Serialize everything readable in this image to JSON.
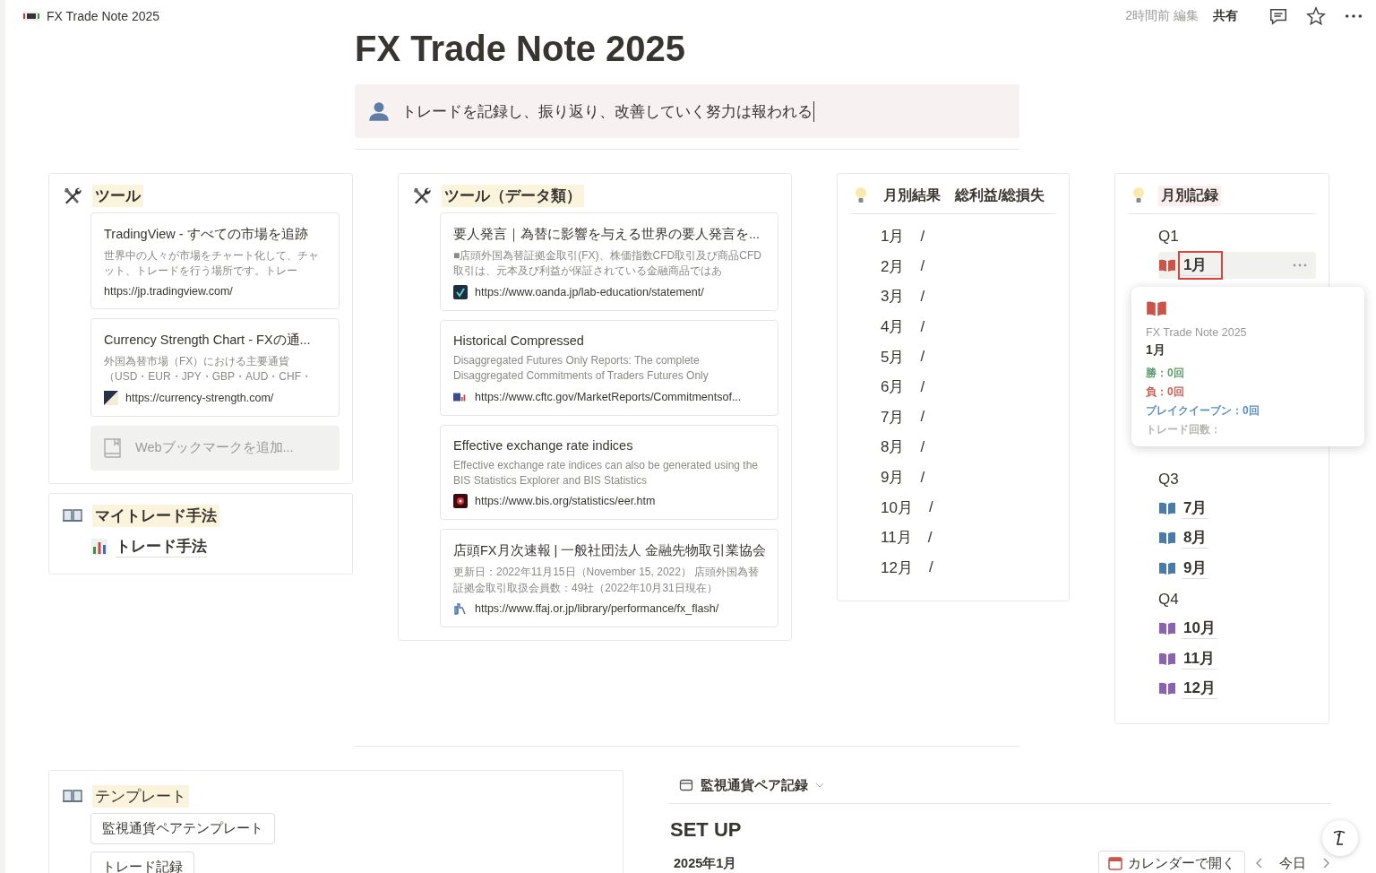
{
  "top_bar": {
    "breadcrumb": "FX Trade Note 2025",
    "edited": "2時間前 編集",
    "share": "共有"
  },
  "title": "FX Trade Note 2025",
  "callout": "トレードを記録し、振り返り、改善していく努力は報われる",
  "columns": [
    {
      "cards": [
        {
          "kind": "bookmarks",
          "heading": "ツール",
          "bookmarks": [
            {
              "title": "TradingView - すべての市場を追跡",
              "description": "世界中の人々が市場をチャート化して、チャット、トレードを行う場所です。トレー",
              "url": "https://jp.tradingview.com/"
            },
            {
              "title": "Currency Strength Chart - FXの通...",
              "description": "外国為替市場（FX）における主要通貨（USD・EUR・JPY・GBP・AUD・CHF・",
              "url": "https://currency-strength.com/"
            }
          ],
          "add_button": "Webブックマークを追加..."
        },
        {
          "kind": "pages",
          "heading": "マイトレード手法",
          "pages": [
            {
              "label": "トレード手法"
            }
          ]
        }
      ]
    },
    {
      "cards": [
        {
          "kind": "bookmarks",
          "heading": "ツール（データ類）",
          "bookmarks": [
            {
              "title": "要人発言｜為替に影響を与える世界の要人発言を...",
              "description": "■店頭外国為替証拠金取引(FX)、株価指数CFD取引及び商品CFD取引は、元本及び利益が保証されている金融商品ではあ",
              "url": "https://www.oanda.jp/lab-education/statement/"
            },
            {
              "title": "Historical Compressed",
              "description": "Disaggregated Futures Only Reports: The complete Disaggregated Commitments of Traders Futures Only",
              "url": "https://www.cftc.gov/MarketReports/Commitmentsof..."
            },
            {
              "title": "Effective exchange rate indices",
              "description": "Effective exchange rate indices can also be generated using the BIS Statistics Explorer and BIS Statistics",
              "url": "https://www.bis.org/statistics/eer.htm"
            },
            {
              "title": "店頭FX月次速報 | 一般社団法人 金融先物取引業協会",
              "description": "更新日：2022年11月15日（November 15, 2022） 店頭外国為替証拠金取引取扱会員数：49社（2022年10月31日現在）",
              "url": "https://www.ffaj.or.jp/library/performance/fx_flash/"
            }
          ]
        }
      ]
    },
    {
      "cards": [
        {
          "kind": "results",
          "heading": "月別結果　総利益/総損失",
          "rows": [
            {
              "month": "1月",
              "value": "/"
            },
            {
              "month": "2月",
              "value": "/"
            },
            {
              "month": "3月",
              "value": "/"
            },
            {
              "month": "4月",
              "value": "/"
            },
            {
              "month": "5月",
              "value": "/"
            },
            {
              "month": "6月",
              "value": "/"
            },
            {
              "month": "7月",
              "value": "/"
            },
            {
              "month": "8月",
              "value": "/"
            },
            {
              "month": "9月",
              "value": "/"
            },
            {
              "month": "10月",
              "value": "/"
            },
            {
              "month": "11月",
              "value": "/"
            },
            {
              "month": "12月",
              "value": "/"
            }
          ]
        }
      ]
    },
    {
      "cards": [
        {
          "kind": "records",
          "heading": "月別記録",
          "groups": [
            {
              "label": "Q1",
              "items": [
                {
                  "label": "1月",
                  "color": "#c9544a",
                  "hovered": true,
                  "annotated": true
                }
              ]
            },
            {
              "label": "Q3",
              "items": [
                {
                  "label": "7月",
                  "color": "#4a7ba7",
                  "hovered": false,
                  "annotated": false
                },
                {
                  "label": "8月",
                  "color": "#4a7ba7",
                  "hovered": false,
                  "annotated": false
                },
                {
                  "label": "9月",
                  "color": "#4a7ba7",
                  "hovered": false,
                  "annotated": false
                }
              ]
            },
            {
              "label": "Q4",
              "items": [
                {
                  "label": "10月",
                  "color": "#8a62b0",
                  "hovered": false,
                  "annotated": false
                },
                {
                  "label": "11月",
                  "color": "#8a62b0",
                  "hovered": false,
                  "annotated": false
                },
                {
                  "label": "12月",
                  "color": "#8a62b0",
                  "hovered": false,
                  "annotated": false
                }
              ]
            }
          ],
          "popover": {
            "parent": "FX Trade Note 2025",
            "title": "1月",
            "properties": [
              {
                "text": "勝：0回",
                "color": "#5b9a6e"
              },
              {
                "text": "負：0回",
                "color": "#d25b55"
              },
              {
                "text": "ブレイクイーブン：0回",
                "color": "#5a8fc4"
              },
              {
                "text": "トレード回数：",
                "color": "#b4b4b0"
              }
            ]
          }
        }
      ]
    }
  ],
  "templates": {
    "heading": "テンプレート",
    "buttons": [
      "監視通貨ペアテンプレート",
      "トレード記録"
    ]
  },
  "calendar": {
    "view": "監視通貨ペア記録",
    "title": "SET UP",
    "month": "2025年1月",
    "open_button": "カレンダーで開く",
    "today": "今日"
  }
}
